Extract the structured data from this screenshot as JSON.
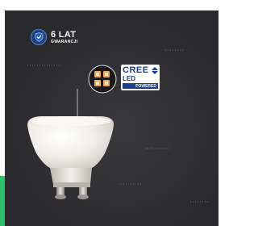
{
  "warranty": {
    "years": "6 LAT",
    "label": "GWARANCJI",
    "icon": "shield-check-icon"
  },
  "cree_logo": {
    "brand": "CREE",
    "led": "LED",
    "powered": "POWERED",
    "icon": "cree-arrows-icon"
  },
  "product": {
    "image": "gu10-led-bulb",
    "chip_detail": "led-chip-closeup"
  },
  "colors": {
    "background": "#2a2a2c",
    "accent": "#2ec06a",
    "cree_blue": "#1d3f86",
    "shield_blue": "#1f3f7a"
  }
}
